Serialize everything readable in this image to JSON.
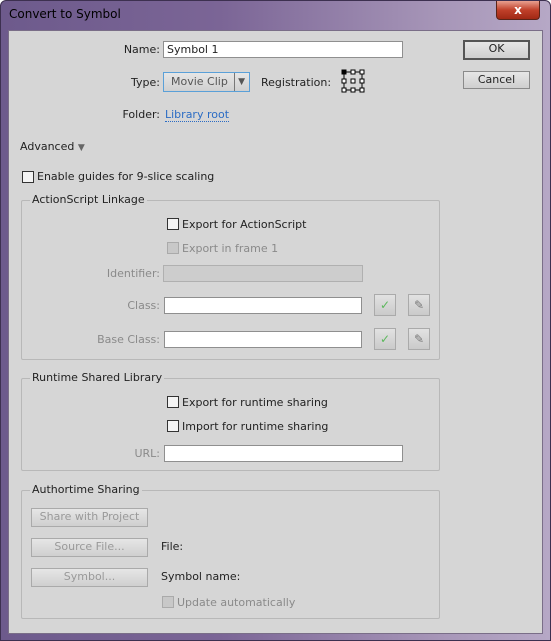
{
  "window": {
    "title": "Convert to Symbol",
    "close_glyph": "x"
  },
  "name": {
    "label": "Name:",
    "value": "Symbol 1"
  },
  "type": {
    "label": "Type:",
    "value": "Movie Clip"
  },
  "registration": {
    "label": "Registration:",
    "selected": "top-left"
  },
  "folder": {
    "label": "Folder:",
    "link": "Library root"
  },
  "buttons": {
    "ok": "OK",
    "cancel": "Cancel"
  },
  "advanced": {
    "label": "Advanced"
  },
  "nine_slice": {
    "label": "Enable guides for 9-slice scaling",
    "checked": false
  },
  "actionscript": {
    "legend": "ActionScript Linkage",
    "export_as": "Export for ActionScript",
    "export_frame": "Export in frame 1",
    "identifier_label": "Identifier:",
    "class_label": "Class:",
    "base_class_label": "Base Class:",
    "class_value": "",
    "base_class_value": ""
  },
  "runtime": {
    "legend": "Runtime Shared Library",
    "export": "Export for runtime sharing",
    "import": "Import for runtime sharing",
    "url_label": "URL:",
    "url_value": ""
  },
  "authortime": {
    "legend": "Authortime Sharing",
    "share": "Share with Project",
    "source": "Source File...",
    "file_label": "File:",
    "symbol": "Symbol...",
    "symbol_name_label": "Symbol name:",
    "update": "Update automatically"
  },
  "colors": {
    "check": "#5cb85c",
    "link": "#2b6cc4"
  }
}
